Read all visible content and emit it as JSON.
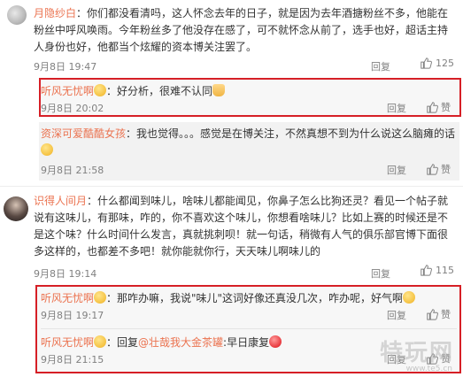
{
  "comments": [
    {
      "username": "月隐纱白",
      "content": "：你们都没看清吗，这人怀念去年的日子，就是因为去年酒搪粉丝不多，他能在粉丝中呼风唤雨。今年粉丝多了他没存在感了，可不就怀念从前了，选手也好，超话主持人身份也好，他都当个炫耀的资本博关注罢了。",
      "time": "9月8日 19:47",
      "reply_label": "回复",
      "likes": "125",
      "sub_replies": [
        {
          "username": "听风无忧啊",
          "content": "：好分析，很难不认同",
          "time": "9月8日 20:02",
          "reply_label": "回复",
          "like_label": "赞",
          "highlighted": true
        },
        {
          "username": "资深可爱酷酷女孩",
          "content": "：我也觉得。。。感觉是在博关注，不然真想不到为什么说这么脑瘫的话",
          "time": "9月8日 21:58",
          "reply_label": "回复",
          "like_label": "赞",
          "highlighted": false
        }
      ]
    },
    {
      "username": "识得人间月",
      "content": "：什么都闻到味儿，啥味儿都能闻见，你鼻子怎么比狗还灵？看见一个帖子就说有这味儿，有那味，咋的，你不喜欢这个味儿，你想看啥味儿？比如上赛的时候还是不是这个味？什么时间什么发言，真就挑刺呗！就一句话，稍微有人气的俱乐部官博下面很多这样的，也都差不多吧！就你能就你行，天天味儿啊味儿的",
      "time": "9月8日 19:14",
      "reply_label": "回复",
      "likes": "115",
      "sub_replies": [
        {
          "username": "听风无忧啊",
          "content": "：那咋办嘛，我说\"味儿\"这词好像还真没几次，咋办呢，好气啊",
          "time": "9月8日 19:17",
          "reply_label": "回复",
          "like_label": "赞",
          "highlighted": true
        },
        {
          "username": "听风无忧啊",
          "reply_prefix": "：回复",
          "mention": "@壮哉我大金茶罐",
          "content": ":早日康复",
          "time": "9月8日 21:15",
          "reply_label": "回复",
          "like_label": "赞",
          "highlighted": true
        }
      ]
    }
  ],
  "watermark": {
    "big": "特玩网",
    "small": "www.te5.cn"
  },
  "colors": {
    "username": "#eb7350",
    "highlight_border": "#d61f26",
    "meta": "#808080"
  },
  "icons": [
    "avatar",
    "thumb-up-icon",
    "emoji-icon"
  ]
}
